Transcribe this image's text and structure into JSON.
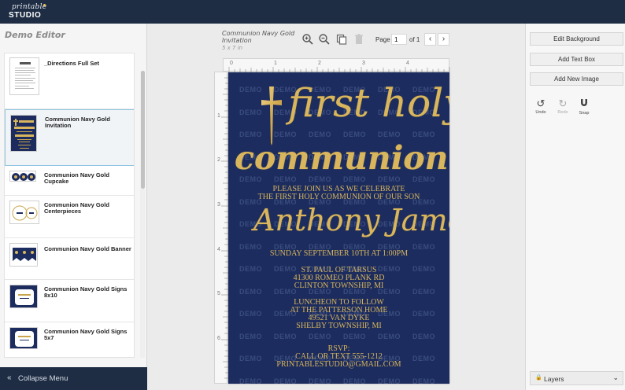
{
  "app": {
    "logo_line1": "printable",
    "logo_line2": "STUDIO"
  },
  "sidebar": {
    "title": "Demo Editor",
    "items": [
      {
        "label": "_Directions Full Set"
      },
      {
        "label": "Communion Navy Gold Invitation"
      },
      {
        "label": "Communion Navy Gold Cupcake"
      },
      {
        "label": "Communion Navy Gold Centerpieces"
      },
      {
        "label": "Communion Navy Gold Banner"
      },
      {
        "label": "Communion Navy Gold Signs 8x10"
      },
      {
        "label": "Communion Navy Gold Signs 5x7"
      }
    ],
    "collapse_label": "Collapse Menu"
  },
  "toolbar": {
    "doc_title": "Communion Navy Gold Invitation",
    "doc_size": "5 x 7 in",
    "page_label": "Page",
    "page_value": "1",
    "page_of": "of 1"
  },
  "ruler": {
    "top": [
      "0",
      "1",
      "2",
      "3",
      "4"
    ],
    "left": [
      "1",
      "2",
      "3",
      "4",
      "5",
      "6"
    ]
  },
  "canvas": {
    "watermark": "DEMO",
    "line_first_holy": "first holy",
    "line_communion": "communion",
    "line_please1": "PLEASE JOIN US AS WE CELEBRATE",
    "line_please2": "THE FIRST HOLY COMMUNION OF OUR SON",
    "name": "Anthony James",
    "date": "SUNDAY SEPTEMBER 10TH AT 1:00PM",
    "venue1": "ST. PAUL OF TARSUS",
    "venue2": "41300 ROMEO PLANK RD",
    "venue3": "CLINTON TOWNSHIP, MI",
    "lunch1": "LUNCHEON TO FOLLOW",
    "lunch2": "AT THE PATTERSON HOME",
    "lunch3": "49521 VAN DYKE",
    "lunch4": "SHELBY TOWNSHIP, MI",
    "rsvp1": "RSVP:",
    "rsvp2": "CALL OR TEXT 555-1212",
    "rsvp3": "PRINTABLESTUDIO@GMAIL.COM"
  },
  "right_panel": {
    "edit_background": "Edit Background",
    "add_text_box": "Add Text Box",
    "add_new_image": "Add New Image",
    "undo": "Undo",
    "redo": "Redo",
    "snap": "Snap",
    "layers": "Layers"
  },
  "colors": {
    "navy": "#1c2c5e",
    "gold": "#d9b65d",
    "topbar": "#1e2d44"
  }
}
